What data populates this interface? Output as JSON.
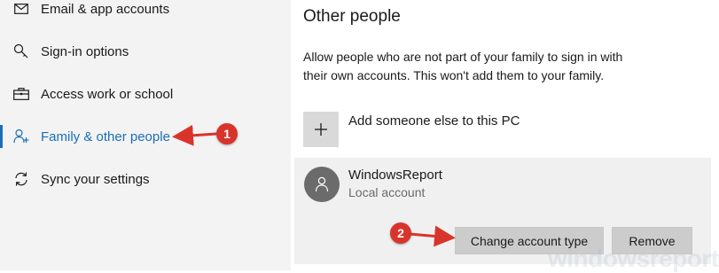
{
  "sidebar": {
    "items": [
      {
        "label": "Email & app accounts",
        "icon": "envelope-icon"
      },
      {
        "label": "Sign-in options",
        "icon": "key-icon"
      },
      {
        "label": "Access work or school",
        "icon": "briefcase-icon"
      },
      {
        "label": "Family & other people",
        "icon": "person-add-icon",
        "active": true
      },
      {
        "label": "Sync your settings",
        "icon": "sync-icon"
      }
    ]
  },
  "main": {
    "title": "Other people",
    "description": "Allow people who are not part of your family to sign in with their own accounts. This won't add them to your family.",
    "add_label": "Add someone else to this PC",
    "account": {
      "name": "WindowsReport",
      "type": "Local account"
    },
    "buttons": {
      "change_type": "Change account type",
      "remove": "Remove"
    }
  },
  "annotations": {
    "badge_1": "1",
    "badge_2": "2",
    "watermark": "windowsreport"
  },
  "colors": {
    "accent": "#1a6fb7",
    "annotation": "#d9342b"
  }
}
